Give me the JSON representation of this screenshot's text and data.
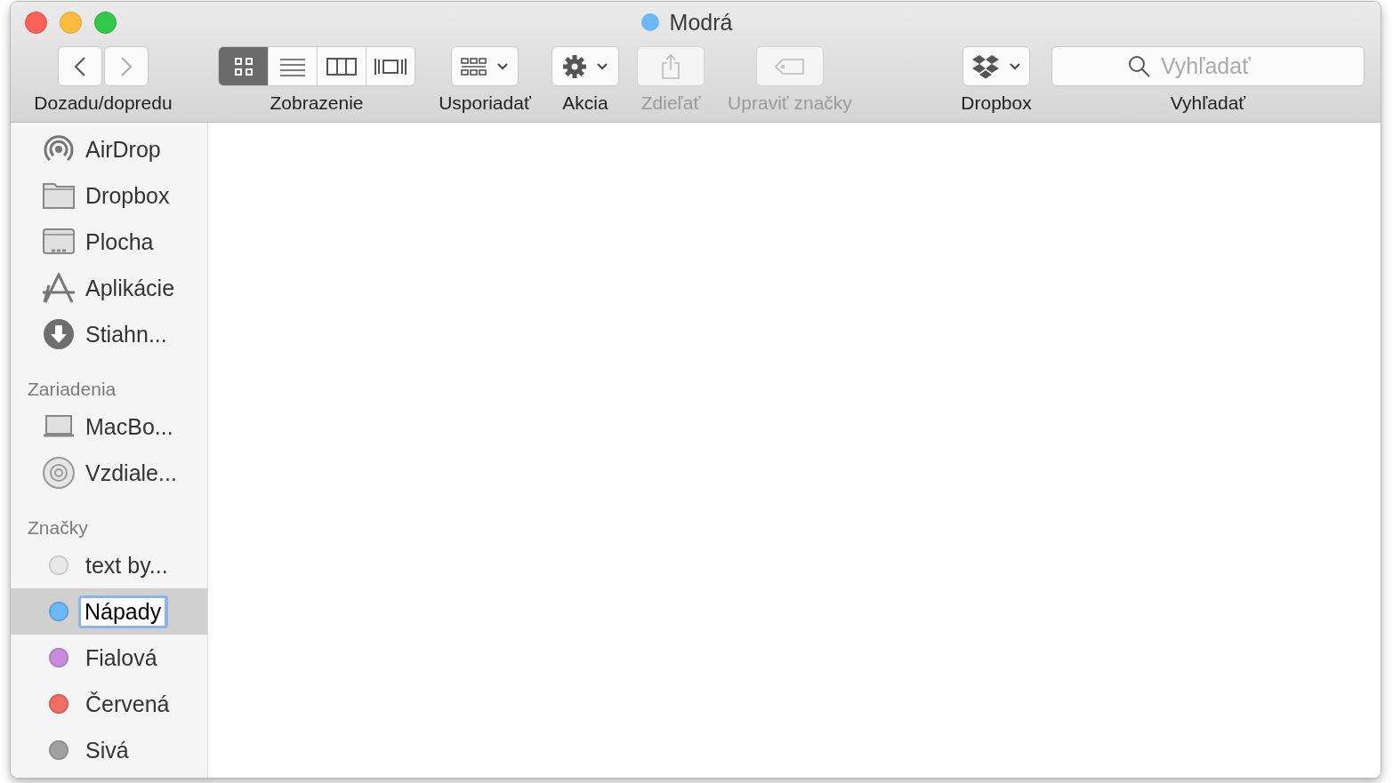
{
  "window": {
    "title": "Modrá",
    "color": "#6ab8f5"
  },
  "toolbar": [
    {
      "kind": "nav",
      "label": "Dozadu/dopredu",
      "disabled": false
    },
    {
      "kind": "view",
      "label": "Zobrazenie",
      "disabled": false,
      "modes": [
        {
          "kind": "icons",
          "selected": true
        },
        {
          "kind": "list",
          "selected": false
        },
        {
          "kind": "columns",
          "selected": false
        },
        {
          "kind": "coverflow",
          "selected": false
        }
      ]
    },
    {
      "kind": "arrange",
      "label": "Usporiadať",
      "disabled": false
    },
    {
      "kind": "action",
      "label": "Akcia",
      "disabled": false
    },
    {
      "kind": "share",
      "label": "Zdieľať",
      "disabled": true
    },
    {
      "kind": "tags",
      "label": "Upraviť značky",
      "disabled": true
    },
    {
      "kind": "dropbox",
      "label": "Dropbox",
      "disabled": false
    },
    {
      "kind": "search",
      "label": "Vyhľadať",
      "placeholder": "Vyhľadať",
      "disabled": false
    }
  ],
  "sidebar": {
    "sections": [
      {
        "items": [
          {
            "kind": "airdrop",
            "label": "AirDrop",
            "selected": false
          },
          {
            "kind": "folder",
            "label": "Dropbox",
            "selected": false
          },
          {
            "kind": "desktop",
            "label": "Plocha",
            "selected": false
          },
          {
            "kind": "apps",
            "label": "Aplikácie",
            "selected": false
          },
          {
            "kind": "download",
            "label": "Stiahn...",
            "selected": false
          }
        ]
      },
      {
        "heading": "Zariadenia",
        "items": [
          {
            "kind": "laptop",
            "label": "MacBo...",
            "selected": false
          },
          {
            "kind": "disc",
            "label": "Vzdiale...",
            "selected": false
          }
        ]
      },
      {
        "heading": "Značky",
        "items": [
          {
            "kind": "tag",
            "color": "#e8e8e8",
            "label": "text by...",
            "selected": false
          },
          {
            "kind": "tag",
            "color": "#6ab8f5",
            "label": "Nápady",
            "selected": true
          },
          {
            "kind": "tag",
            "color": "#c98bdf",
            "label": "Fialová",
            "selected": false
          },
          {
            "kind": "tag",
            "color": "#ef6d62",
            "label": "Červená",
            "selected": false
          },
          {
            "kind": "tag",
            "color": "#a0a0a0",
            "label": "Sivá",
            "selected": false
          }
        ]
      }
    ]
  }
}
